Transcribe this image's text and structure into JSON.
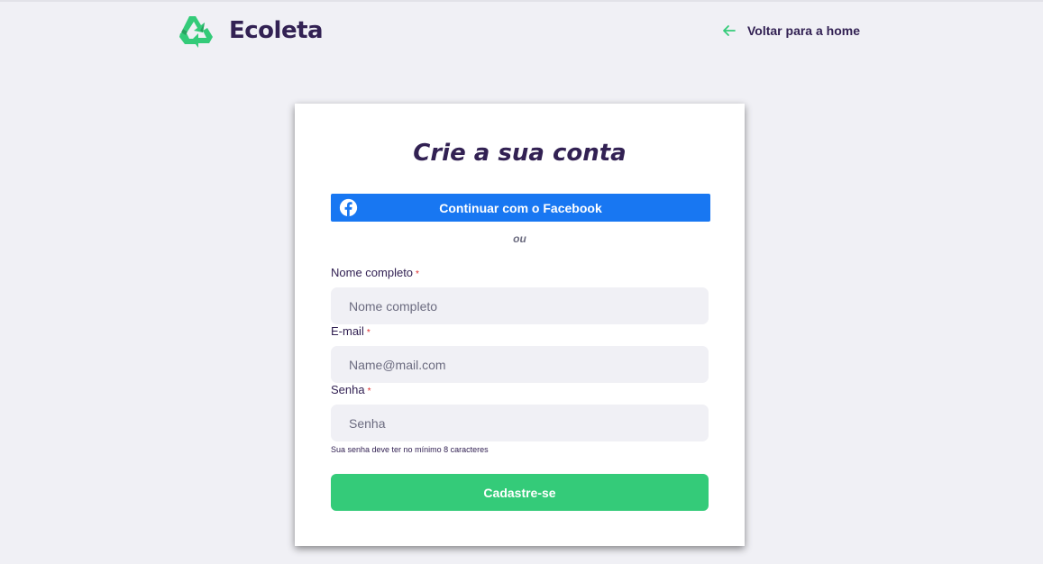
{
  "header": {
    "brand": "Ecoleta",
    "back_link": "Voltar para a home"
  },
  "signup": {
    "title": "Crie a sua conta",
    "facebook_label": "Continuar com o Facebook",
    "or_text": "ou",
    "required_mark": "*",
    "fields": {
      "name": {
        "label": "Nome completo",
        "placeholder": "Nome completo",
        "value": ""
      },
      "email": {
        "label": "E-mail",
        "placeholder": "Name@mail.com",
        "value": ""
      },
      "password": {
        "label": "Senha",
        "placeholder": "Senha",
        "value": ""
      }
    },
    "password_hint": "Sua senha deve ter no mínimo 8 caracteres",
    "submit_label": "Cadastre-se"
  },
  "colors": {
    "background": "#f0f0f5",
    "title": "#322153",
    "primary": "#34cb79",
    "facebook": "#1877f2",
    "required": "#e02d2d"
  },
  "icons": {
    "logo": "recycle-icon",
    "back": "arrow-left-icon",
    "facebook": "facebook-icon"
  }
}
